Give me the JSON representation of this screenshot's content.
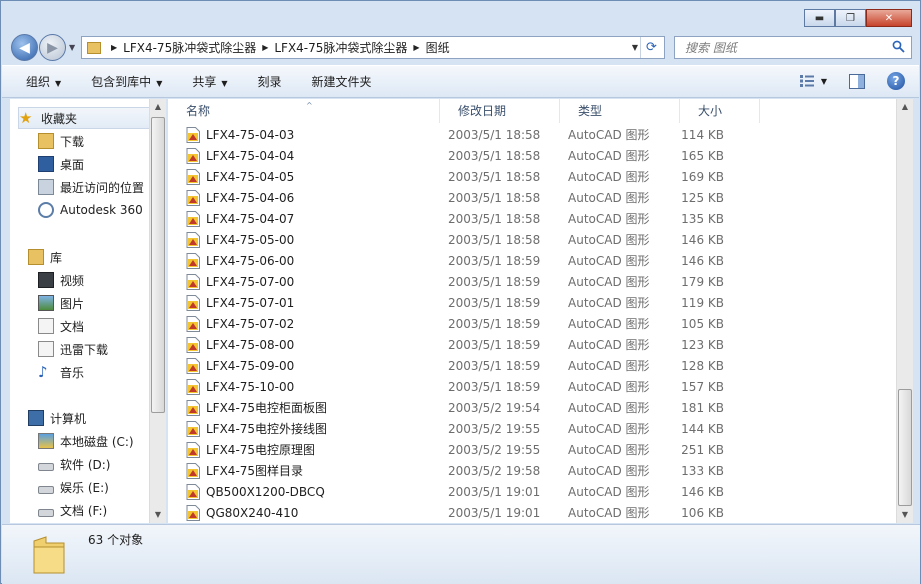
{
  "window": {
    "caption_buttons": {
      "minimize": "▬",
      "maximize": "❐",
      "close": "✕"
    }
  },
  "address": {
    "crumbs": [
      "LFX4-75脉冲袋式除尘器",
      "LFX4-75脉冲袋式除尘器",
      "图纸"
    ],
    "separator": "▶",
    "dropdown": "▼"
  },
  "search": {
    "placeholder": "搜索 图纸"
  },
  "toolbar": {
    "organize": "组织",
    "include_in_library": "包含到库中",
    "share": "共享",
    "burn": "刻录",
    "new_folder": "新建文件夹",
    "arrow": "▼"
  },
  "nav": {
    "favorites": {
      "label": "收藏夹",
      "items": [
        "下载",
        "桌面",
        "最近访问的位置",
        "Autodesk 360"
      ]
    },
    "libraries": {
      "label": "库",
      "items": [
        "视频",
        "图片",
        "文档",
        "迅雷下载",
        "音乐"
      ]
    },
    "computer": {
      "label": "计算机",
      "items": [
        "本地磁盘 (C:)",
        "软件 (D:)",
        "娱乐 (E:)",
        "文档 (F:)"
      ]
    }
  },
  "columns": {
    "name": "名称",
    "modified": "修改日期",
    "type": "类型",
    "size": "大小"
  },
  "files": [
    {
      "name": "LFX4-75-04-03",
      "date": "2003/5/1 18:58",
      "type": "AutoCAD 图形",
      "size": "114 KB"
    },
    {
      "name": "LFX4-75-04-04",
      "date": "2003/5/1 18:58",
      "type": "AutoCAD 图形",
      "size": "165 KB"
    },
    {
      "name": "LFX4-75-04-05",
      "date": "2003/5/1 18:58",
      "type": "AutoCAD 图形",
      "size": "169 KB"
    },
    {
      "name": "LFX4-75-04-06",
      "date": "2003/5/1 18:58",
      "type": "AutoCAD 图形",
      "size": "125 KB"
    },
    {
      "name": "LFX4-75-04-07",
      "date": "2003/5/1 18:58",
      "type": "AutoCAD 图形",
      "size": "135 KB"
    },
    {
      "name": "LFX4-75-05-00",
      "date": "2003/5/1 18:58",
      "type": "AutoCAD 图形",
      "size": "146 KB"
    },
    {
      "name": "LFX4-75-06-00",
      "date": "2003/5/1 18:59",
      "type": "AutoCAD 图形",
      "size": "146 KB"
    },
    {
      "name": "LFX4-75-07-00",
      "date": "2003/5/1 18:59",
      "type": "AutoCAD 图形",
      "size": "179 KB"
    },
    {
      "name": "LFX4-75-07-01",
      "date": "2003/5/1 18:59",
      "type": "AutoCAD 图形",
      "size": "119 KB"
    },
    {
      "name": "LFX4-75-07-02",
      "date": "2003/5/1 18:59",
      "type": "AutoCAD 图形",
      "size": "105 KB"
    },
    {
      "name": "LFX4-75-08-00",
      "date": "2003/5/1 18:59",
      "type": "AutoCAD 图形",
      "size": "123 KB"
    },
    {
      "name": "LFX4-75-09-00",
      "date": "2003/5/1 18:59",
      "type": "AutoCAD 图形",
      "size": "128 KB"
    },
    {
      "name": "LFX4-75-10-00",
      "date": "2003/5/1 18:59",
      "type": "AutoCAD 图形",
      "size": "157 KB"
    },
    {
      "name": "LFX4-75电控柜面板图",
      "date": "2003/5/2 19:54",
      "type": "AutoCAD 图形",
      "size": "181 KB"
    },
    {
      "name": "LFX4-75电控外接线图",
      "date": "2003/5/2 19:55",
      "type": "AutoCAD 图形",
      "size": "144 KB"
    },
    {
      "name": "LFX4-75电控原理图",
      "date": "2003/5/2 19:55",
      "type": "AutoCAD 图形",
      "size": "251 KB"
    },
    {
      "name": "LFX4-75图样目录",
      "date": "2003/5/2 19:58",
      "type": "AutoCAD 图形",
      "size": "133 KB"
    },
    {
      "name": "QB500X1200-DBCQ",
      "date": "2003/5/1 19:01",
      "type": "AutoCAD 图形",
      "size": "146 KB"
    },
    {
      "name": "QG80X240-410",
      "date": "2003/5/1 19:01",
      "type": "AutoCAD 图形",
      "size": "106 KB"
    }
  ],
  "status": {
    "count": "63 个对象"
  },
  "icons": {
    "file": "autocad-dwg-icon",
    "folder": "folder-icon",
    "search": "search-icon",
    "refresh": "refresh-icon",
    "help": "help-icon",
    "view": "view-options-icon",
    "preview": "preview-pane-icon"
  },
  "colors": {
    "accent": "#2c64b8",
    "chrome": "#d5e3f3",
    "toolbar": "#dde8f5"
  }
}
